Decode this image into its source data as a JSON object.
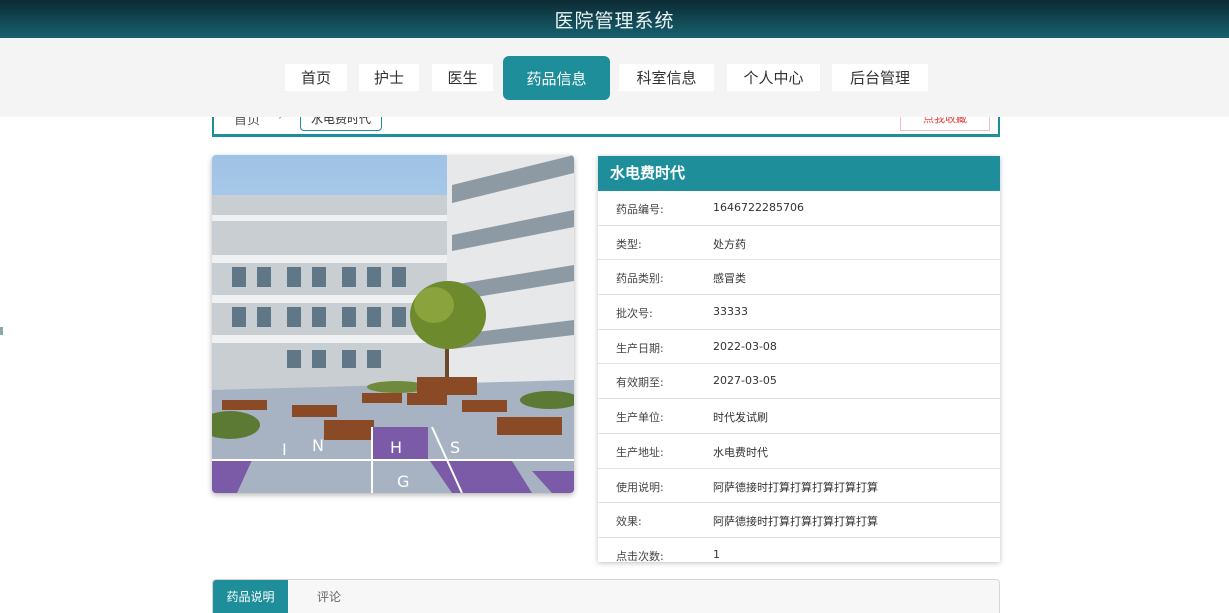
{
  "header": {
    "title": "医院管理系统"
  },
  "nav": [
    {
      "label": "首页"
    },
    {
      "label": "护士"
    },
    {
      "label": "医生"
    },
    {
      "label": "药品信息"
    },
    {
      "label": "科室信息"
    },
    {
      "label": "个人中心"
    },
    {
      "label": "后台管理"
    }
  ],
  "breadcrumb": {
    "home": "首页",
    "separator": "›",
    "current": "水电费时代"
  },
  "favorite": {
    "label": "点我收藏"
  },
  "detail": {
    "title": "水电费时代",
    "rows": [
      {
        "label": "药品编号:",
        "value": "1646722285706"
      },
      {
        "label": "类型:",
        "value": "处方药"
      },
      {
        "label": "药品类别:",
        "value": "感冒类"
      },
      {
        "label": "批次号:",
        "value": "33333"
      },
      {
        "label": "生产日期:",
        "value": "2022-03-08"
      },
      {
        "label": "有效期至:",
        "value": "2027-03-05"
      },
      {
        "label": "生产单位:",
        "value": "时代发试刷"
      },
      {
        "label": "生产地址:",
        "value": "水电费时代"
      },
      {
        "label": "使用说明:",
        "value": "阿萨德接时打算打算打算打算打算"
      },
      {
        "label": "效果:",
        "value": "阿萨德接时打算打算打算打算打算"
      },
      {
        "label": "点击次数:",
        "value": "1"
      }
    ]
  },
  "tabs": [
    {
      "label": "药品说明"
    },
    {
      "label": "评论"
    }
  ],
  "colors": {
    "accent": "#1e8e9b",
    "header_dark": "#0c2a33"
  }
}
